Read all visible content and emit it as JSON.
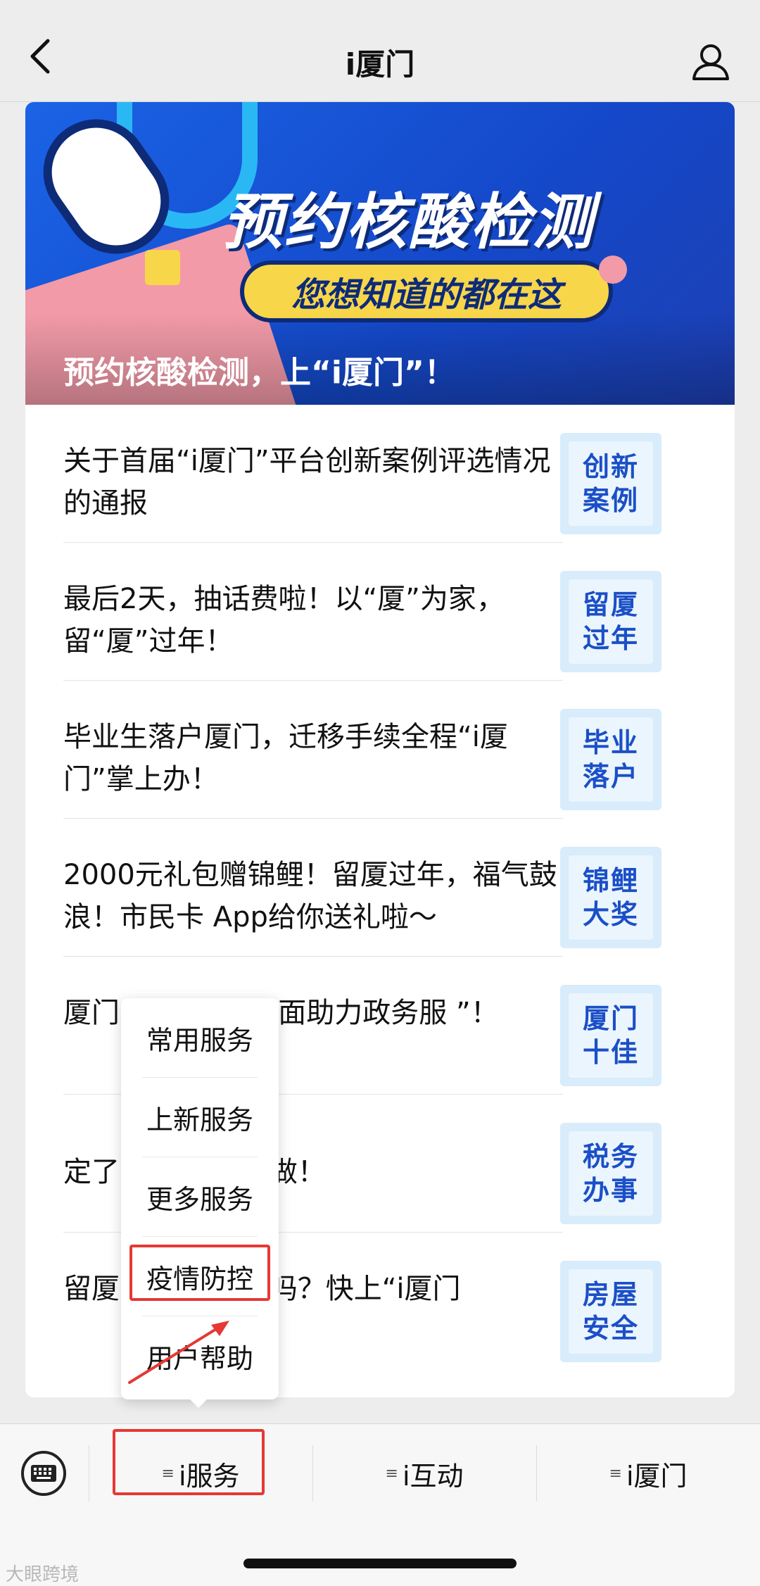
{
  "header": {
    "title": "i厦门",
    "back_icon": "chevron-left-icon",
    "profile_icon": "user-icon"
  },
  "banner": {
    "headline": "预约核酸检测",
    "subline": "您想知道的都在这",
    "caption": "预约核酸检测，上“i厦门”！"
  },
  "articles": [
    {
      "title": "关于首届“i厦门”平台创新案例评选情况的通报",
      "thumb": "创新案例"
    },
    {
      "title": "最后2天，抽话费啦！以“厦”为家，留“厦”过年！",
      "thumb": "留厦过年"
    },
    {
      "title": "毕业生落户厦门，迁移手续全程“i厦门”掌上办！",
      "thumb": "毕业落户"
    },
    {
      "title": "2000元礼包赠锦鲤！留厦过年，福气鼓浪！市民卡 App给你送礼啦～",
      "thumb": "锦鲤大奖"
    },
    {
      "title": "厦门 ！“i厦门”全面助力政务服 ”！",
      "thumb": "厦门十佳"
    },
    {
      "title": "定了 门税务这样做！",
      "thumb": "税务办事"
    },
    {
      "title": "留厦 的房子安全吗？快上“i厦门",
      "thumb": "房屋安全"
    }
  ],
  "popup_menu": {
    "items": [
      "常用服务",
      "上新服务",
      "更多服务",
      "疫情防控",
      "用户帮助"
    ],
    "highlighted": "疫情防控"
  },
  "bottom_menu": {
    "keyboard_icon": "keyboard-icon",
    "tabs": [
      "i服务",
      "i互动",
      "i厦门"
    ],
    "highlighted": "i服务",
    "menu_icon": "menu-lines-icon"
  },
  "watermark": "大眼跨境",
  "colors": {
    "highlight": "#e53935",
    "banner_blue": "#1b63e6",
    "thumb_text": "#1b4fc7",
    "pill_yellow": "#f8d64a"
  }
}
